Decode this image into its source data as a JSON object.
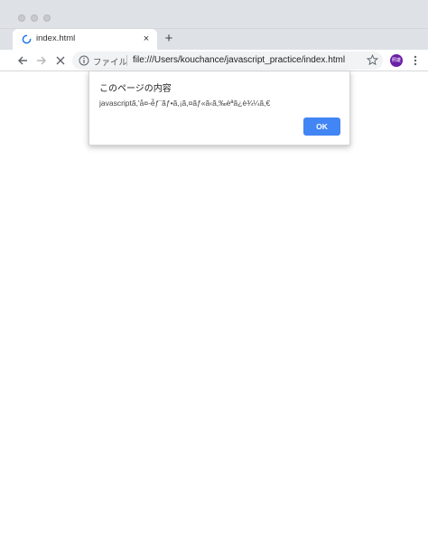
{
  "tab": {
    "title": "index.html",
    "close": "×",
    "new_tab": "+"
  },
  "toolbar": {
    "scheme_label": "ファイル",
    "url": "file:///Users/kouchance/javascript_practice/index.html",
    "avatar_text": "照雄"
  },
  "icons": {
    "back": "arrow-left-icon",
    "forward": "arrow-right-icon",
    "stop": "close-icon",
    "info": "info-icon",
    "star": "star-icon",
    "menu": "kebab-menu-icon",
    "spinner": "loading-spinner-icon"
  },
  "dialog": {
    "title": "このページの内容",
    "message": "javascriptã,'å¤-é̃ƒ¨ãƒ•ã,¡ã,¤ãƒ«ã‹ã,‰èª­ã¿è¾¼ã,€",
    "ok_label": "OK"
  },
  "colors": {
    "accent": "#4285f4",
    "avatar": "#6a1fa8",
    "chrome_frame": "#dee1e6",
    "omnibox": "#f1f3f4"
  }
}
